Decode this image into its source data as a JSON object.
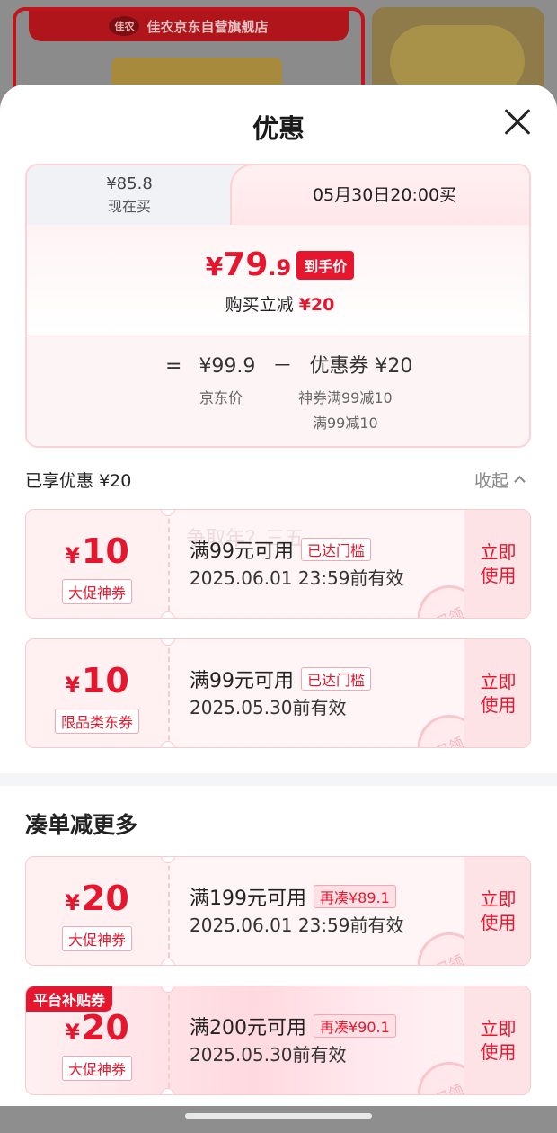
{
  "background": {
    "store_logo": "佳农",
    "store_name": "佳农京东自营旗舰店"
  },
  "sheet": {
    "title": "优惠",
    "close_icon": "close-icon"
  },
  "price_compare": {
    "now_price": "¥85.8",
    "now_label": "现在买",
    "later_label": "05月30日20:00买",
    "final_yen": "¥",
    "final_int": "79",
    "final_dec": ".9",
    "final_tag": "到手价",
    "reduce_label": "购买立减",
    "reduce_amount": "¥20",
    "equals": "=",
    "jd_price": "¥99.9",
    "minus": "－",
    "coupon_total": "优惠券 ¥20",
    "jd_price_label": "京东价",
    "coupon_detail_1": "神券满99减10",
    "coupon_detail_2": "满99减10"
  },
  "enjoyed": {
    "label": "已享优惠",
    "amount": "¥20",
    "collapse_label": "收起"
  },
  "coupons_enjoyed": [
    {
      "yen": "¥",
      "amount": "10",
      "type": "大促神券",
      "condition": "满99元可用",
      "tag": "已达门槛",
      "validity": "2025.06.01 23:59前有效",
      "action": "立即使用",
      "stamp": "已领",
      "watermark": "争取年？三五"
    },
    {
      "yen": "¥",
      "amount": "10",
      "type": "限品类东券",
      "condition": "满99元可用",
      "tag": "已达门槛",
      "validity": "2025.05.30前有效",
      "action": "立即使用",
      "stamp": "已领"
    }
  ],
  "more_section": {
    "title": "凑单减更多"
  },
  "coupons_more": [
    {
      "yen": "¥",
      "amount": "20",
      "type": "大促神券",
      "condition": "满199元可用",
      "tag": "再凑¥89.1",
      "validity": "2025.06.01 23:59前有效",
      "action": "立即使用",
      "stamp": "已领"
    },
    {
      "badge": "平台补贴券",
      "yen": "¥",
      "amount": "20",
      "type": "大促神券",
      "condition": "满200元可用",
      "tag": "再凑¥90.1",
      "validity": "2025.05.30前有效",
      "action": "立即使用",
      "stamp": "已领"
    }
  ],
  "colors": {
    "accent_red": "#e5162d",
    "coupon_border": "#f8c9cf",
    "coupon_bg": "#fff5f6"
  }
}
